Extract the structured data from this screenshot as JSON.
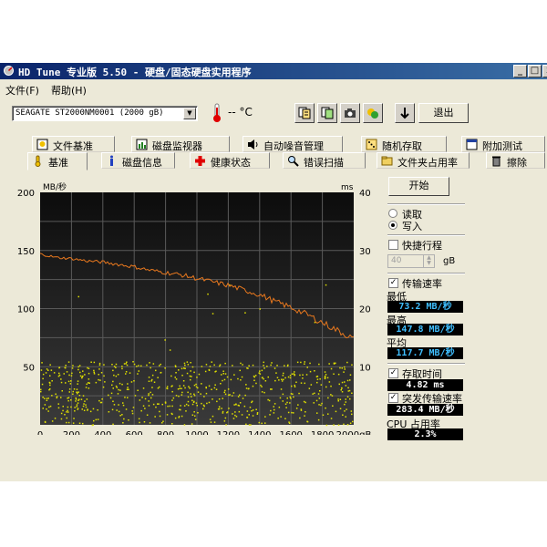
{
  "window": {
    "title": "HD Tune 专业版 5.50 - 硬盘/固态硬盘实用程序",
    "min": "_",
    "max": "□",
    "close": "x"
  },
  "menu": [
    "文件(F)",
    "帮助(H)"
  ],
  "toolbar": {
    "drive": "SEAGATE ST2000NM0001 (2000 gB)",
    "temperature": "-- °C",
    "exit_label": "退出",
    "icons": [
      "copy-text-icon",
      "copy-screenshot-icon",
      "camera-icon",
      "health-icon",
      "download-icon"
    ]
  },
  "tabs_row1": [
    {
      "label": "文件基准",
      "icon": "file-benchmark-icon"
    },
    {
      "label": "磁盘监视器",
      "icon": "disk-monitor-icon"
    },
    {
      "label": "自动噪音管理",
      "icon": "speaker-icon"
    },
    {
      "label": "随机存取",
      "icon": "random-access-icon"
    },
    {
      "label": "附加测试",
      "icon": "extra-tests-icon"
    }
  ],
  "tabs_row2": [
    {
      "label": "基准",
      "icon": "benchmark-icon",
      "active": true
    },
    {
      "label": "磁盘信息",
      "icon": "info-icon"
    },
    {
      "label": "健康状态",
      "icon": "health-cross-icon"
    },
    {
      "label": "错误扫描",
      "icon": "magnifier-icon"
    },
    {
      "label": "文件夹占用率",
      "icon": "folder-icon"
    },
    {
      "label": "擦除",
      "icon": "trash-icon"
    }
  ],
  "chart_data": {
    "type": "line",
    "left_unit": "MB/秒",
    "right_unit": "ms",
    "x_ticks": [
      "0",
      "200",
      "400",
      "600",
      "800",
      "1000",
      "1200",
      "1400",
      "1600",
      "1800",
      "2000gB"
    ],
    "y_left_ticks": [
      "200",
      "150",
      "100",
      "50"
    ],
    "y_right_ticks": [
      "40",
      "30",
      "20",
      "10"
    ],
    "xlim": [
      0,
      2000
    ],
    "ylim_left": [
      0,
      200
    ],
    "ylim_right": [
      0,
      40
    ],
    "grid": true,
    "series": [
      {
        "color": "#e8781e",
        "x": [
          0,
          100,
          200,
          300,
          400,
          500,
          600,
          700,
          800,
          900,
          1000,
          1100,
          1200,
          1300,
          1400,
          1500,
          1600,
          1700,
          1800,
          1900,
          2000
        ],
        "values": [
          147,
          144,
          143,
          141,
          140,
          138,
          136,
          133,
          131,
          129,
          126,
          123,
          120,
          116,
          112,
          106,
          101,
          95,
          88,
          81,
          74
        ]
      }
    ],
    "scatter_color": "#e0e000",
    "scatter_y_range_ms": [
      0,
      11
    ]
  },
  "side": {
    "start_label": "开始",
    "read_label": "读取",
    "write_label": "写入",
    "quick_label": "快捷行程",
    "quick_value": "40",
    "quick_unit": "gB",
    "transfer_label": "传输速率",
    "min_label": "最低",
    "min_value": "73.2 MB/秒",
    "max_label": "最高",
    "max_value": "147.8 MB/秒",
    "avg_label": "平均",
    "avg_value": "117.7 MB/秒",
    "access_label": "存取时间",
    "access_value": "4.82 ms",
    "burst_label": "突发传输速率",
    "burst_value": "283.4 MB/秒",
    "cpu_label": "CPU 占用率",
    "cpu_value": "2.3%"
  }
}
